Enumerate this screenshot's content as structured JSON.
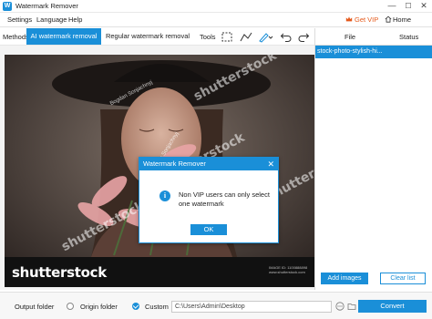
{
  "window": {
    "title": "Watermark Remover",
    "controls": {
      "minimize": "—",
      "maximize": "☐",
      "close": "✕"
    }
  },
  "menu": {
    "items": [
      "Settings",
      "Language",
      "Help"
    ],
    "vip_label": "Get VIP",
    "home_label": "Home"
  },
  "toolbar": {
    "methods_label": "Methods:",
    "tab_ai": "AI watermark removal",
    "tab_regular": "Regular watermark removal",
    "tools_label": "Tools",
    "tool_icons": [
      "rect-select-icon",
      "polyline-icon",
      "brush-icon",
      "undo-icon",
      "redo-icon"
    ]
  },
  "file_list": {
    "col_file": "File",
    "col_status": "Status",
    "rows": [
      {
        "name": "stock-photo-stylish-hi..."
      }
    ]
  },
  "image": {
    "watermark_text": "shutterstock",
    "credit_text": "Bogdan Sonjachnyj",
    "logo_text": "shutterstock",
    "meta_line1": "IMAGE ID: 1100888898",
    "meta_line2": "www.shutterstock.com"
  },
  "dialog": {
    "title": "Watermark Remover",
    "close": "✕",
    "message": "Non VIP users can only select one watermark",
    "ok_label": "OK"
  },
  "actions": {
    "add_images": "Add images",
    "clear_list": "Clear list"
  },
  "output": {
    "label": "Output folder",
    "origin_label": "Origin folder",
    "custom_label": "Custom",
    "path_value": "C:\\Users\\Admin\\Desktop",
    "convert_label": "Convert",
    "selected": "custom"
  },
  "colors": {
    "accent": "#1a8fd8",
    "vip": "#e55a1c"
  }
}
